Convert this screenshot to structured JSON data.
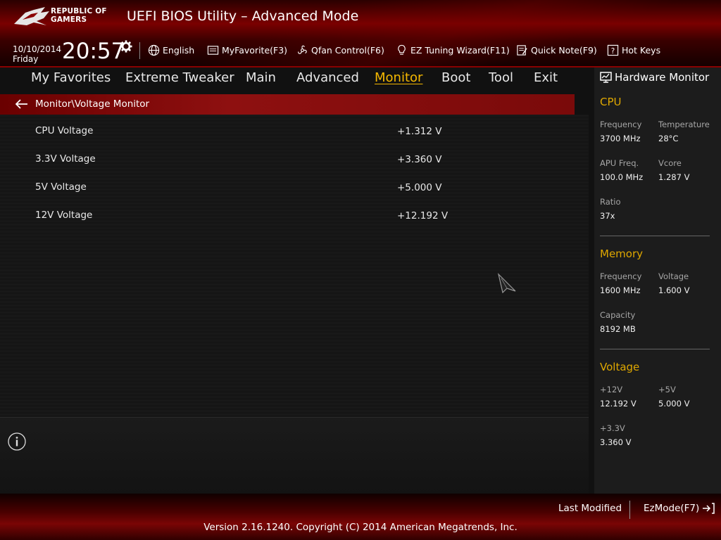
{
  "header": {
    "logo_line1": "REPUBLIC OF",
    "logo_line2": "GAMERS",
    "title": "UEFI BIOS Utility – Advanced Mode",
    "date": "10/10/2014",
    "weekday": "Friday",
    "time": "20:57"
  },
  "toolbar": {
    "language": "English",
    "myfavorite": "MyFavorite(F3)",
    "qfan": "Qfan Control(F6)",
    "ez_tuning": "EZ Tuning Wizard(F11)",
    "quick_note": "Quick Note(F9)",
    "hot_keys": "Hot Keys"
  },
  "nav": {
    "items": [
      "My Favorites",
      "Extreme Tweaker",
      "Main",
      "Advanced",
      "Monitor",
      "Boot",
      "Tool",
      "Exit"
    ],
    "active": "Monitor"
  },
  "breadcrumb": "Monitor\\Voltage Monitor",
  "voltages": [
    {
      "label": "CPU Voltage",
      "value": "+1.312 V"
    },
    {
      "label": "3.3V Voltage",
      "value": "+3.360 V"
    },
    {
      "label": "5V Voltage",
      "value": "+5.000 V"
    },
    {
      "label": "12V Voltage",
      "value": "+12.192 V"
    }
  ],
  "hardware_monitor": {
    "title": "Hardware Monitor",
    "cpu": {
      "heading": "CPU",
      "frequency_label": "Frequency",
      "frequency": "3700 MHz",
      "temperature_label": "Temperature",
      "temperature": "28°C",
      "apu_label": "APU Freq.",
      "apu": "100.0 MHz",
      "vcore_label": "Vcore",
      "vcore": "1.287 V",
      "ratio_label": "Ratio",
      "ratio": "37x"
    },
    "memory": {
      "heading": "Memory",
      "frequency_label": "Frequency",
      "frequency": "1600 MHz",
      "voltage_label": "Voltage",
      "voltage": "1.600 V",
      "capacity_label": "Capacity",
      "capacity": "8192 MB"
    },
    "voltage": {
      "heading": "Voltage",
      "v12_label": "+12V",
      "v12": "12.192 V",
      "v5_label": "+5V",
      "v5": "5.000 V",
      "v33_label": "+3.3V",
      "v33": "3.360 V"
    }
  },
  "footer": {
    "last_modified": "Last Modified",
    "ezmode": "EzMode(F7)",
    "copyright": "Version 2.16.1240. Copyright (C) 2014 American Megatrends, Inc."
  },
  "colors": {
    "accent": "#f5b800",
    "section": "#e0a800",
    "brand_red": "#8e1010"
  }
}
